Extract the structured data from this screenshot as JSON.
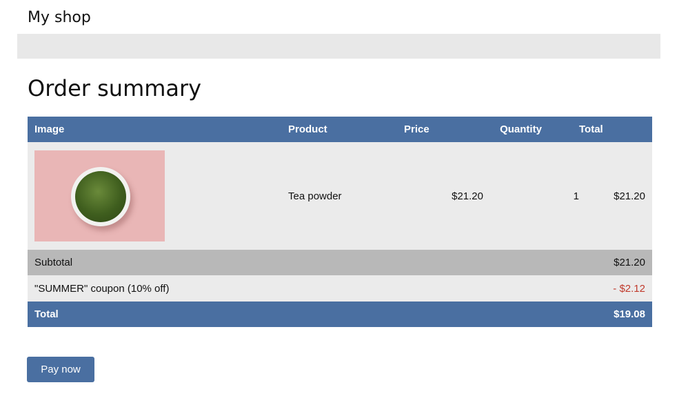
{
  "header": {
    "shop_title": "My shop"
  },
  "main": {
    "page_title": "Order summary"
  },
  "table": {
    "headers": {
      "image": "Image",
      "product": "Product",
      "price": "Price",
      "quantity": "Quantity",
      "total": "Total"
    },
    "items": [
      {
        "product": "Tea powder",
        "price": "$21.20",
        "quantity": "1",
        "total": "$21.20"
      }
    ],
    "subtotal": {
      "label": "Subtotal",
      "value": "$21.20"
    },
    "coupon": {
      "label": "\"SUMMER\" coupon (10% off)",
      "value": "- $2.12"
    },
    "grand_total": {
      "label": "Total",
      "value": "$19.08"
    }
  },
  "actions": {
    "pay_label": "Pay now"
  },
  "colors": {
    "accent": "#4a6fa1",
    "row_light": "#ebebeb",
    "row_subtotal": "#b8b8b8",
    "discount": "#c0392b"
  }
}
